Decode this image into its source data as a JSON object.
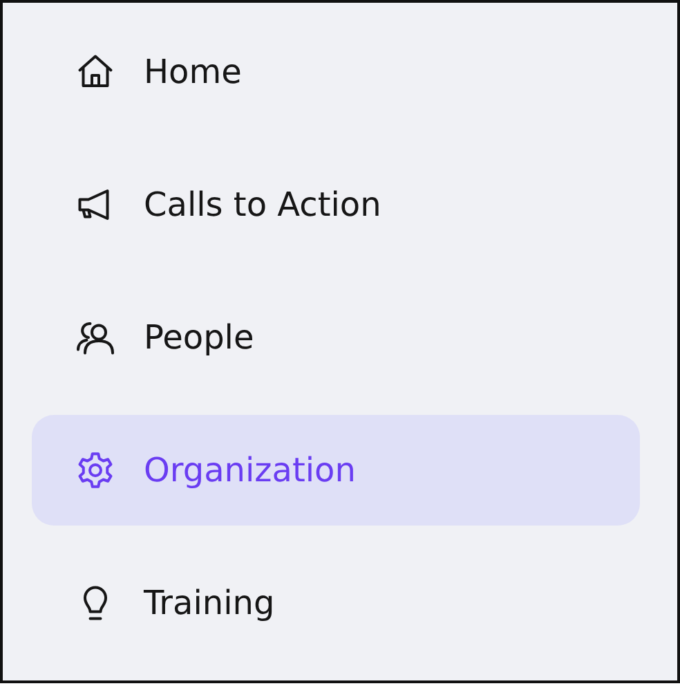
{
  "sidebar": {
    "items": [
      {
        "kind": "home",
        "label": "Home",
        "selected": false
      },
      {
        "kind": "megaphone",
        "label": "Calls to Action",
        "selected": false
      },
      {
        "kind": "people",
        "label": "People",
        "selected": false
      },
      {
        "kind": "gear",
        "label": "Organization",
        "selected": true
      },
      {
        "kind": "bulb",
        "label": "Training",
        "selected": false
      }
    ]
  }
}
